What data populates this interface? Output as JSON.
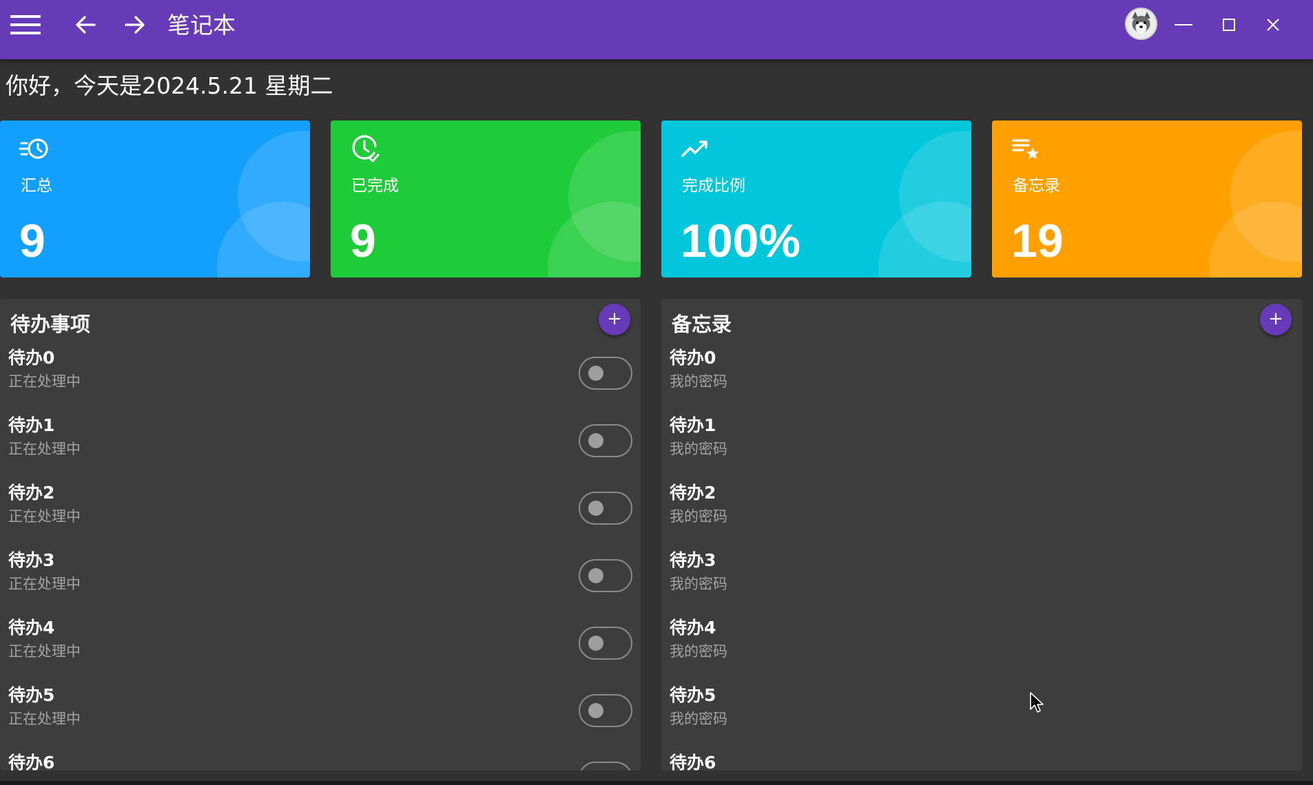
{
  "colors": {
    "titlebar": "#673ab7",
    "background": "#323232",
    "panel": "#3d3d3d",
    "card_total": "#139ffd",
    "card_done": "#1ecb39",
    "card_ratio": "#02c6dc",
    "card_memo": "#ffa000",
    "accent_button": "#673ab7"
  },
  "titlebar": {
    "title": "笔记本",
    "menu_icon": "hamburger-menu-icon",
    "back_icon": "arrow-left-icon",
    "forward_icon": "arrow-right-icon",
    "avatar_icon": "user-avatar",
    "minimize_icon": "minimize-icon",
    "maximize_icon": "maximize-icon",
    "close_icon": "close-icon"
  },
  "greeting": "你好，今天是2024.5.21 星期二",
  "stats": [
    {
      "label": "汇总",
      "value": "9",
      "icon": "clock-fast-icon",
      "color": "#139ffd"
    },
    {
      "label": "已完成",
      "value": "9",
      "icon": "clock-check-icon",
      "color": "#1ecb39"
    },
    {
      "label": "完成比例",
      "value": "100%",
      "icon": "trending-up-icon",
      "color": "#02c6dc"
    },
    {
      "label": "备忘录",
      "value": "19",
      "icon": "playlist-star-icon",
      "color": "#ffa000"
    }
  ],
  "todo": {
    "title": "待办事项",
    "add_label": "+",
    "items": [
      {
        "title": "待办0",
        "status": "正在处理中",
        "done": false
      },
      {
        "title": "待办1",
        "status": "正在处理中",
        "done": false
      },
      {
        "title": "待办2",
        "status": "正在处理中",
        "done": false
      },
      {
        "title": "待办3",
        "status": "正在处理中",
        "done": false
      },
      {
        "title": "待办4",
        "status": "正在处理中",
        "done": false
      },
      {
        "title": "待办5",
        "status": "正在处理中",
        "done": false
      },
      {
        "title": "待办6",
        "status": "",
        "done": false
      }
    ]
  },
  "memo": {
    "title": "备忘录",
    "add_label": "+",
    "items": [
      {
        "title": "待办0",
        "content": "我的密码"
      },
      {
        "title": "待办1",
        "content": "我的密码"
      },
      {
        "title": "待办2",
        "content": "我的密码"
      },
      {
        "title": "待办3",
        "content": "我的密码"
      },
      {
        "title": "待办4",
        "content": "我的密码"
      },
      {
        "title": "待办5",
        "content": "我的密码"
      },
      {
        "title": "待办6",
        "content": ""
      }
    ]
  }
}
